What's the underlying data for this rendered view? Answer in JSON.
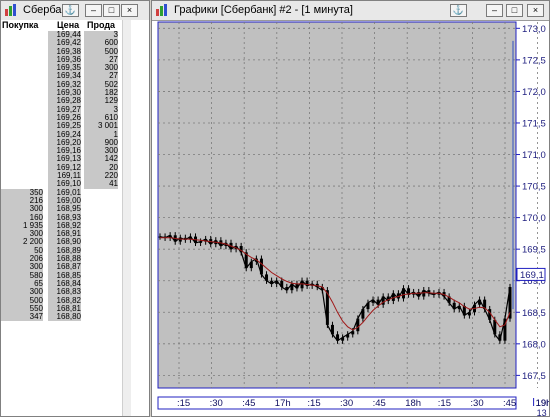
{
  "order_book": {
    "title": "Сбербан",
    "headers": {
      "bid": "Покупка",
      "price": "Цена",
      "ask": "Прода"
    },
    "rows": [
      {
        "bid": "",
        "price": "169,44",
        "ask": "3"
      },
      {
        "bid": "",
        "price": "169,42",
        "ask": "600"
      },
      {
        "bid": "",
        "price": "169,38",
        "ask": "500"
      },
      {
        "bid": "",
        "price": "169,36",
        "ask": "27"
      },
      {
        "bid": "",
        "price": "169,35",
        "ask": "300"
      },
      {
        "bid": "",
        "price": "169,34",
        "ask": "27"
      },
      {
        "bid": "",
        "price": "169,32",
        "ask": "502"
      },
      {
        "bid": "",
        "price": "169,30",
        "ask": "182"
      },
      {
        "bid": "",
        "price": "169,28",
        "ask": "129"
      },
      {
        "bid": "",
        "price": "169,27",
        "ask": "3"
      },
      {
        "bid": "",
        "price": "169,26",
        "ask": "610"
      },
      {
        "bid": "",
        "price": "169,25",
        "ask": "3 001"
      },
      {
        "bid": "",
        "price": "169,24",
        "ask": "1"
      },
      {
        "bid": "",
        "price": "169,20",
        "ask": "900"
      },
      {
        "bid": "",
        "price": "169,16",
        "ask": "300"
      },
      {
        "bid": "",
        "price": "169,13",
        "ask": "142"
      },
      {
        "bid": "",
        "price": "169,12",
        "ask": "20"
      },
      {
        "bid": "",
        "price": "169,11",
        "ask": "220"
      },
      {
        "bid": "",
        "price": "169,10",
        "ask": "41"
      },
      {
        "bid": "350",
        "price": "169,01",
        "ask": ""
      },
      {
        "bid": "216",
        "price": "169,00",
        "ask": ""
      },
      {
        "bid": "300",
        "price": "168,95",
        "ask": ""
      },
      {
        "bid": "160",
        "price": "168,93",
        "ask": ""
      },
      {
        "bid": "1 935",
        "price": "168,92",
        "ask": ""
      },
      {
        "bid": "300",
        "price": "168,91",
        "ask": ""
      },
      {
        "bid": "2 200",
        "price": "168,90",
        "ask": ""
      },
      {
        "bid": "50",
        "price": "168,89",
        "ask": ""
      },
      {
        "bid": "206",
        "price": "168,88",
        "ask": ""
      },
      {
        "bid": "300",
        "price": "168,87",
        "ask": ""
      },
      {
        "bid": "580",
        "price": "168,85",
        "ask": ""
      },
      {
        "bid": "65",
        "price": "168,84",
        "ask": ""
      },
      {
        "bid": "300",
        "price": "168,83",
        "ask": ""
      },
      {
        "bid": "500",
        "price": "168,82",
        "ask": ""
      },
      {
        "bid": "550",
        "price": "168,81",
        "ask": ""
      },
      {
        "bid": "347",
        "price": "168,80",
        "ask": ""
      }
    ]
  },
  "chart_window": {
    "title": "Графики [Сбербанк] #2 - [1 минута]",
    "price_tag": "169,1"
  },
  "window_buttons": {
    "pin": "⚓",
    "minimize": "‒",
    "maximize": "□",
    "close": "×"
  },
  "colors": {
    "chart_bg": "#c0c0c0",
    "grid": "#7a7a7a",
    "axis": "#2020c0",
    "candle": "#000000",
    "ma": "#a01818",
    "ask_cells": "#c8c8c8",
    "bid_cells": "#c8c8c8"
  },
  "chart_data": {
    "type": "line",
    "y_ticks": [
      "173,0",
      "172,5",
      "172,0",
      "171,5",
      "171,0",
      "170,5",
      "170,0",
      "169,5",
      "169,0",
      "168,5",
      "168,0",
      "167,5"
    ],
    "ylim": [
      167.3,
      173.1
    ],
    "x_ticks": [
      ":15",
      ":30",
      ":45",
      "17h",
      ":15",
      ":30",
      ":45",
      "18h",
      ":15",
      ":30",
      ":45",
      "19h"
    ],
    "x_sublabel": "13",
    "grid": true,
    "series": [
      {
        "values": [
          169.7,
          169.68,
          169.72,
          169.62,
          169.68,
          169.65,
          169.7,
          169.6,
          169.62,
          169.66,
          169.58,
          169.64,
          169.55,
          169.6,
          169.5,
          169.55,
          169.45,
          169.2,
          169.3,
          169.35,
          169.1,
          169.0,
          168.95,
          169.0,
          168.9,
          168.85,
          168.95,
          168.88,
          169.0,
          168.92,
          168.95,
          168.9,
          168.85,
          168.3,
          168.15,
          168.05,
          168.1,
          168.15,
          168.2,
          168.4,
          168.55,
          168.65,
          168.7,
          168.62,
          168.75,
          168.68,
          168.8,
          168.72,
          168.88,
          168.78,
          168.82,
          168.75,
          168.85,
          168.8,
          168.78,
          168.82,
          168.75,
          168.65,
          168.55,
          168.6,
          168.45,
          168.5,
          168.62,
          168.7,
          168.55,
          168.38,
          168.15,
          168.05,
          168.4,
          168.9
        ]
      },
      {
        "values": [
          169.68,
          169.68,
          169.68,
          169.67,
          169.66,
          169.66,
          169.66,
          169.65,
          169.64,
          169.63,
          169.62,
          169.61,
          169.6,
          169.58,
          169.55,
          169.52,
          169.48,
          169.42,
          169.37,
          169.33,
          169.27,
          169.2,
          169.13,
          169.08,
          169.03,
          168.99,
          168.96,
          168.95,
          168.95,
          168.94,
          168.93,
          168.92,
          168.9,
          168.8,
          168.66,
          168.5,
          168.36,
          168.27,
          168.22,
          168.26,
          168.34,
          168.44,
          168.53,
          168.6,
          168.66,
          168.7,
          168.73,
          168.75,
          168.78,
          168.79,
          168.8,
          168.8,
          168.81,
          168.81,
          168.8,
          168.8,
          168.78,
          168.74,
          168.69,
          168.65,
          168.59,
          168.55,
          168.56,
          168.58,
          168.57,
          168.5,
          168.38,
          168.27,
          168.3,
          168.5
        ]
      }
    ]
  }
}
